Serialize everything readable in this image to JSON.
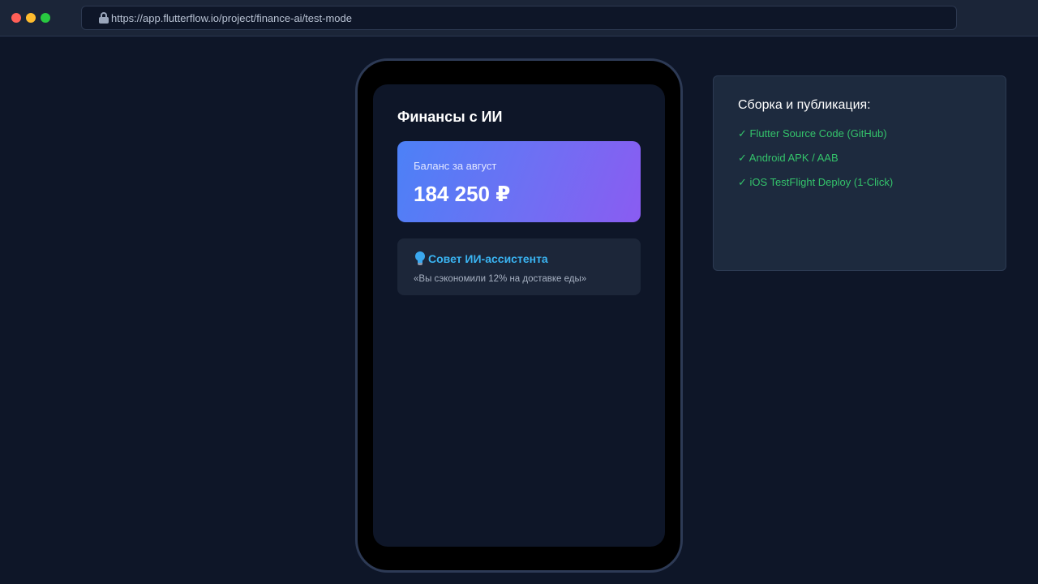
{
  "browser": {
    "url": "https://app.flutterflow.io/project/finance-ai/test-mode",
    "lock_icon": "lock-icon"
  },
  "app": {
    "title": "Финансы с ИИ",
    "balance": {
      "label": "Баланс за август",
      "amount": "184 250 ₽"
    },
    "tip": {
      "icon": "lightbulb-icon",
      "title": "Совет ИИ-ассистента",
      "text": "«Вы сэкономили 12% на доставке еды»"
    }
  },
  "build": {
    "title": "Сборка и публикация:",
    "items": [
      "✓ Flutter Source Code (GitHub)",
      "✓ Android APK / AAB",
      "✓ iOS TestFlight Deploy (1-Click)"
    ]
  },
  "colors": {
    "background": "#0e1628",
    "gradient_start": "#4c81f7",
    "gradient_end": "#8a5cf2",
    "tip_accent": "#3ab4f2",
    "success": "#34c36b"
  }
}
